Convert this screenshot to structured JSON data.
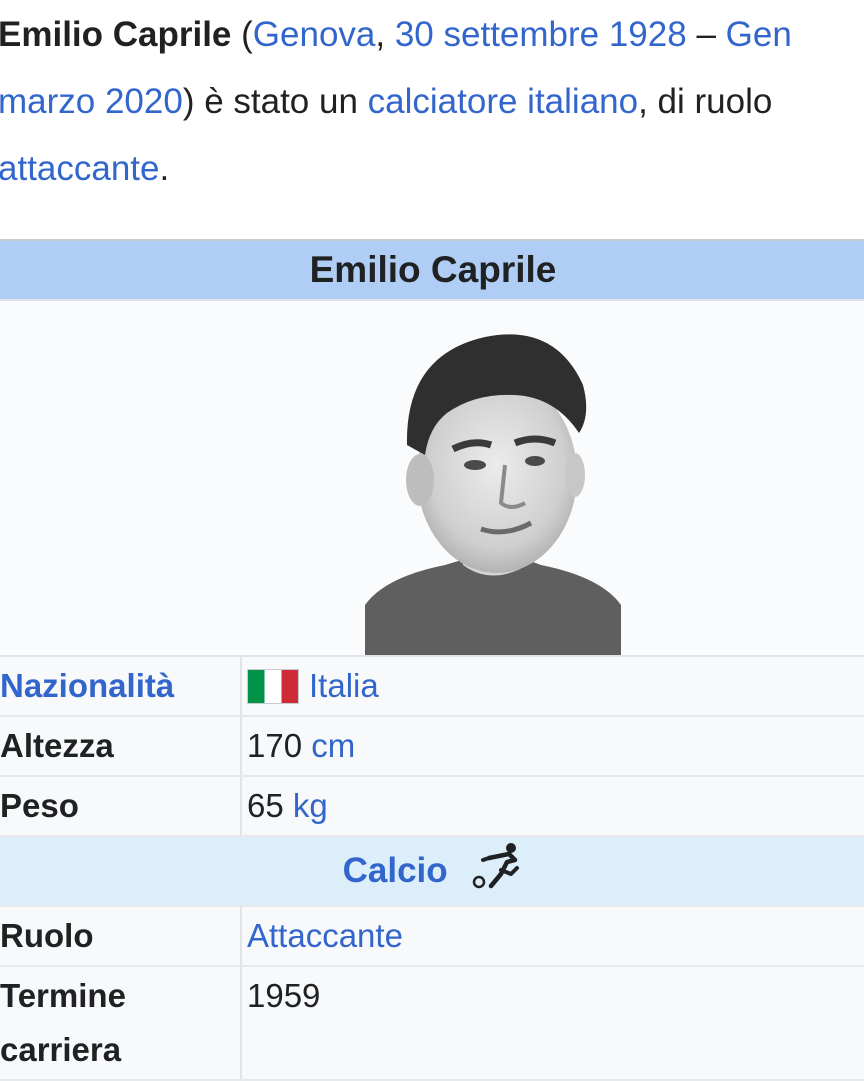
{
  "intro": {
    "name": "Emilio Caprile",
    "open_paren": " (",
    "birth_place": "Genova",
    "comma1": ", ",
    "birth_date": "30 settembre 1928",
    "dash": " – ",
    "death_place": "Gen",
    "death_date": "marzo 2020",
    "mid": ") è stato un ",
    "profession": "calciatore italiano",
    "role_text": ", di ruolo",
    "role_link": "attaccante",
    "period": "."
  },
  "infobox": {
    "title": "Emilio Caprile",
    "rows": [
      {
        "label": "Nazionalità",
        "value": "Italia"
      },
      {
        "label": "Altezza",
        "value": "170",
        "unit": "cm"
      },
      {
        "label": "Peso",
        "value": "65",
        "unit": "kg"
      }
    ],
    "section": "Calcio",
    "section_icon": "football-player-icon",
    "rows2": [
      {
        "label": "Ruolo",
        "value": "Attaccante"
      },
      {
        "label": "Termine carriera",
        "value": "1959"
      }
    ],
    "flag_colors": [
      "#009246",
      "#ffffff",
      "#ce2b37"
    ]
  },
  "colors": {
    "link": "#3366cc",
    "title_bg": "#b0cef5",
    "section_bg": "#ddeefb"
  }
}
